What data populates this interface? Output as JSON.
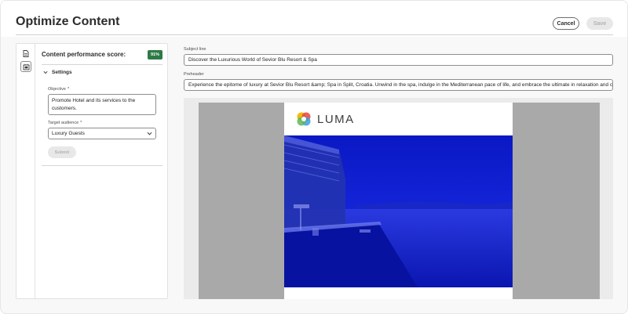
{
  "header": {
    "title": "Optimize Content",
    "cancel_label": "Cancel",
    "save_label": "Save"
  },
  "left_panel": {
    "rail_icons": [
      "document-icon",
      "brush-ai-icon"
    ],
    "score_label": "Content performance score:",
    "score_value": "91%",
    "score_color": "#2d7a46",
    "settings_label": "Settings",
    "objective_label": "Objective",
    "objective_value": "Promote Hotel and its services to the customers.",
    "audience_label": "Target audience",
    "audience_value": "Luxury Guests",
    "submit_label": "Submit",
    "required_marker": "*"
  },
  "right_panel": {
    "subject_label": "Subject line",
    "subject_value": "Discover the Luxurious World of Sevior Blu Resort & Spa",
    "preheader_label": "Preheader",
    "preheader_value": "Experience the epitome of luxury at Sevior Blu Resort &amp; Spa in Split, Croatia. Unwind in the spa, indulge in the Mediterranean pace of life, and embrace the ultimate in relaxation and comfo…"
  },
  "preview": {
    "brand_name": "LUMA",
    "hero_color": "#0f1fd0"
  }
}
